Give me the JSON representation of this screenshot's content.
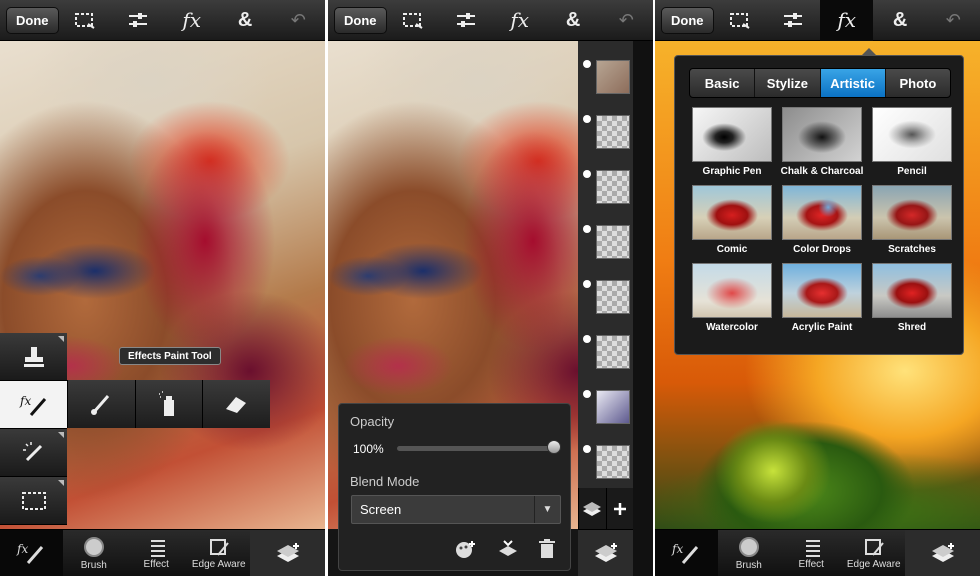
{
  "panels": {
    "left": {
      "done_label": "Done",
      "tooltip": "Effects Paint Tool",
      "side_tools": [
        "stamp-tool",
        "effects-paint-tool",
        "magic-wand-tool",
        "marquee-select-tool"
      ],
      "row_tools": [
        "brush-tool",
        "spray-tool",
        "eraser-tool"
      ],
      "bottom": {
        "brush": "Brush",
        "effect": "Effect",
        "edge_aware": "Edge Aware"
      }
    },
    "middle": {
      "done_label": "Done",
      "opacity_label": "Opacity",
      "opacity_value": "100%",
      "opacity_fraction": 1.0,
      "blend_mode_label": "Blend Mode",
      "blend_mode_value": "Screen",
      "layer_count": 9
    },
    "right": {
      "done_label": "Done",
      "tabs": [
        "Basic",
        "Stylize",
        "Artistic",
        "Photo"
      ],
      "active_tab": "Artistic",
      "effects": [
        "Graphic Pen",
        "Chalk & Charcoal",
        "Pencil",
        "Comic",
        "Color Drops",
        "Scratches",
        "Watercolor",
        "Acrylic Paint",
        "Shred"
      ],
      "bottom": {
        "brush": "Brush",
        "effect": "Effect",
        "edge_aware": "Edge Aware"
      }
    }
  },
  "colors": {
    "accent_blue": "#1a8ad6",
    "toolbar": "#2a2a2a"
  }
}
